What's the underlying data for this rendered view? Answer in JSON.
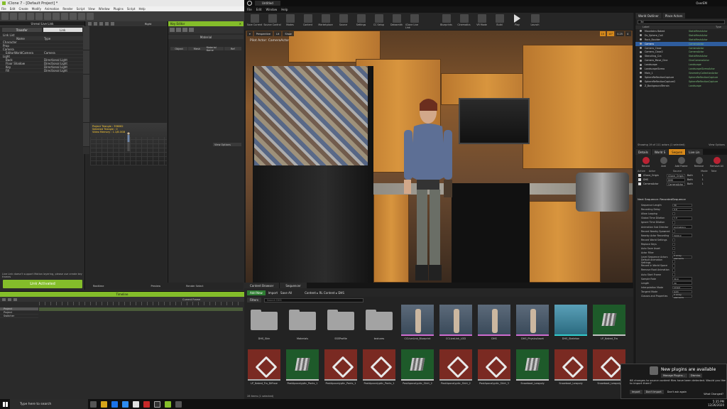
{
  "iclone": {
    "title": "iClone 7 - [Default Project] *",
    "menu": [
      "File",
      "Edit",
      "Create",
      "Modify",
      "Animation",
      "Render",
      "Script",
      "View",
      "Window",
      "Plugins",
      "Script",
      "Help"
    ],
    "livelink": {
      "header": "Unreal Live Link",
      "btn_transfer": "Transfer",
      "btn_link": "Link",
      "list_label": "Link List",
      "col_name": "Name",
      "col_type": "Type",
      "rows": [
        {
          "name": "Character",
          "type": ""
        },
        {
          "name": "Prop",
          "type": ""
        },
        {
          "name": "Camera",
          "type": ""
        },
        {
          "name": "EditorWorldCamera",
          "type": "Camera"
        },
        {
          "name": "Light",
          "type": ""
        },
        {
          "name": "Back",
          "type": "Directional Light"
        },
        {
          "name": "Floor Shadow",
          "type": "Directional Light"
        },
        {
          "name": "Key",
          "type": "Directional Light"
        },
        {
          "name": "Fill",
          "type": "Directional Light"
        }
      ],
      "note": "Live Link doesn't support Motion layering, please use create key frames",
      "link_button": "Link Activated"
    },
    "viewport": {
      "mode": "Right",
      "info": "Project Triangle : 396062\nSelected Triangle : 0\nVideo Memory : 1.1/8.0GB"
    },
    "side_tabs": [
      "Stage",
      "Set",
      "Smart Gallery",
      "Tools",
      "Character"
    ],
    "keypanel": {
      "header": "Key Editor",
      "material": "Material",
      "cols": [
        "Object",
        "Mesh",
        "Material Name",
        "Ref"
      ],
      "view": "View Options"
    },
    "bottom_strip": [
      "Realtime",
      "Preview",
      "Render Select"
    ],
    "timeline": {
      "header": "Timeline",
      "current_frame": "Current Frame",
      "rows": [
        "Project",
        "Project",
        "Switcher"
      ]
    }
  },
  "unreal": {
    "title_tab": "Untitled",
    "right_title": "OverEM",
    "menu": [
      "File",
      "Edit",
      "Window",
      "Help"
    ],
    "toolbar": [
      "Save Current",
      "Source Control",
      "Modes",
      "Content",
      "Marketplace",
      "Source",
      "Settings",
      "CC Setup",
      "Datasmith",
      "iClone Live Link",
      "Blueprints",
      "Cinematics",
      "VR Mode",
      "Build",
      "Play",
      "Launch"
    ],
    "viewport": {
      "tabs": [
        "Perspective",
        "Lit",
        "Show"
      ],
      "cam": "Pilot Actor: CameraActor",
      "right": [
        "10",
        "10°",
        "0.25",
        "4"
      ]
    },
    "content_browser": {
      "tabs": [
        "Content Browser",
        "Sequencer"
      ],
      "add_new": "Add New",
      "import": "Import",
      "save_all": "Save All",
      "path": [
        "Content",
        "RL Content",
        "DHS"
      ],
      "filters": "Filters",
      "search_placeholder": "Search DHS",
      "assets": [
        {
          "name": "DHS_Skin",
          "kind": "folder"
        },
        {
          "name": "Materials",
          "kind": "folder"
        },
        {
          "name": "SSSProfile",
          "kind": "folder"
        },
        {
          "name": "textures",
          "kind": "folder"
        },
        {
          "name": "CCLiveLink_Blueprint",
          "kind": "mesh"
        },
        {
          "name": "CCLiveLink_LOD",
          "kind": "mesh"
        },
        {
          "name": "DHS",
          "kind": "mesh"
        },
        {
          "name": "DHS_PhysicsAsset",
          "kind": "mesh"
        },
        {
          "name": "DHS_Skeleton",
          "kind": "skel"
        },
        {
          "name": "LP_Naked_Tra",
          "kind": "tex"
        },
        {
          "name": "LP_Naked_Tra_Diffuse",
          "kind": "mat"
        },
        {
          "name": "PostApocalyptic_Pants_1",
          "kind": "tex"
        },
        {
          "name": "PostApocalyptic_Pants_1",
          "kind": "mat"
        },
        {
          "name": "PostApocalyptic_Pants_1",
          "kind": "mat"
        },
        {
          "name": "PostApocalyptic_Shirt_2",
          "kind": "tex"
        },
        {
          "name": "PostApocalyptic_Shirt_2",
          "kind": "mat"
        },
        {
          "name": "PostApocalyptic_Shirt_3",
          "kind": "mat"
        },
        {
          "name": "Snowboot_Lowpoly",
          "kind": "tex"
        },
        {
          "name": "Snowboot_Lowpoly",
          "kind": "mat"
        },
        {
          "name": "Snowboot_Lowpoly",
          "kind": "mat"
        }
      ],
      "footer": "28 items (1 selected)"
    },
    "outliner": {
      "tabs": [
        "World Outliner",
        "Place Actors"
      ],
      "search": "3d",
      "col_label": "Label",
      "col_type": "Type",
      "rows": [
        {
          "name": "Mountains Baked",
          "type": "StaticMeshActor"
        },
        {
          "name": "Dv_Sphere_Coll",
          "type": "StaticMeshActor"
        },
        {
          "name": "Rock_Boulder",
          "type": "StaticMeshActor"
        },
        {
          "name": "Camera",
          "type": "CameraActor",
          "sel": true
        },
        {
          "name": "Camera_Close",
          "type": "CameraActor"
        },
        {
          "name": "Camera_Close2",
          "type": "CameraActor"
        },
        {
          "name": "Stenciling_Cra",
          "type": "StaticMeshActor"
        },
        {
          "name": "Camera_Move_Cine",
          "type": "CineCameraActor"
        },
        {
          "name": "Landscape",
          "type": "Landscape"
        },
        {
          "name": "LandscapeGizmo",
          "type": "LandscapeGizmoActor"
        },
        {
          "name": "Main_1",
          "type": "GeometryCollectionActor"
        },
        {
          "name": "SphereReflectionCapture",
          "type": "SphereReflectionCapture"
        },
        {
          "name": "SphereReflectionCapture2",
          "type": "SphereReflectionCapture"
        },
        {
          "name": "Z_BackgroundTerrain",
          "type": "Landscape"
        }
      ],
      "footer_left": "Showing 19 of 111 actors (1 selected)",
      "footer_right": "View Options"
    },
    "details": {
      "tabs": [
        "Details",
        "World S",
        "Sequen",
        "Live Lin"
      ],
      "tools": [
        "Record",
        "Add",
        "Add Frame",
        "Remove",
        "Remove All"
      ],
      "src_cols": [
        "Active",
        "Actor",
        "Source",
        "Mode",
        "Take"
      ],
      "sources": [
        {
          "actor": "iClone_Origin",
          "source": "iClone_Origin",
          "mode": "Both",
          "take": "1"
        },
        {
          "actor": "DHS",
          "source": "DHS",
          "mode": "Both",
          "take": "1"
        },
        {
          "actor": "CameraActor",
          "source": "CameraActor",
          "mode": "Both",
          "take": "1"
        }
      ],
      "next_seq": "Next Sequence: RecordedSequence",
      "props": [
        {
          "k": "Sequence Length",
          "v": "30"
        },
        {
          "k": "Recording Delay",
          "v": "4.0"
        },
        {
          "k": "Allow Looping",
          "v": ""
        },
        {
          "k": "Global Time Dilation",
          "v": "1.0"
        },
        {
          "k": "Ignore Time Dilation",
          "v": ""
        },
        {
          "k": "Animation Sub Director",
          "v": "Animations"
        },
        {
          "k": "Record Nearby Spawned",
          "v": ""
        },
        {
          "k": "Nearby Actor Recording",
          "v": "5000.0"
        },
        {
          "k": "Record World Settings",
          "v": ""
        },
        {
          "k": "Replace Keys",
          "v": ""
        },
        {
          "k": "Auto Save Asset",
          "v": ""
        },
        {
          "k": "Actor Filter",
          "v": ""
        },
        {
          "k": "Level Sequence Actors",
          "v": "2 Array elements"
        },
        {
          "k": "Default Animation Settings",
          "v": ""
        },
        {
          "k": "Record in World Space",
          "v": ""
        },
        {
          "k": "Remove Root Animation",
          "v": ""
        },
        {
          "k": "Auto Start Frame",
          "v": ""
        },
        {
          "k": "Sample Rate",
          "v": "30.0"
        },
        {
          "k": "Length",
          "v": "30"
        },
        {
          "k": "Interpolation Mode",
          "v": "Linear"
        },
        {
          "k": "Tangent Mode",
          "v": "Auto"
        },
        {
          "k": "Classes and Properties",
          "v": "2 Array elements"
        }
      ]
    },
    "notification": {
      "title": "New plugins are available",
      "manage": "Manage Plugins...",
      "dismiss": "Dismiss",
      "text": "68 changes to source content files have been detected. Would you like to import them?",
      "import": "Import",
      "dont_import": "Don't Import",
      "dont_ask": "Don't ask again",
      "what": "What Changed?"
    }
  },
  "taskbar": {
    "search": "Type here to search",
    "time": "5:35 PM",
    "date": "12/26/2020"
  },
  "colors": {
    "iclone_accent": "#84bd2a",
    "ue_selection": "#2f5d9e",
    "vp_highlight": "#d7891a"
  }
}
